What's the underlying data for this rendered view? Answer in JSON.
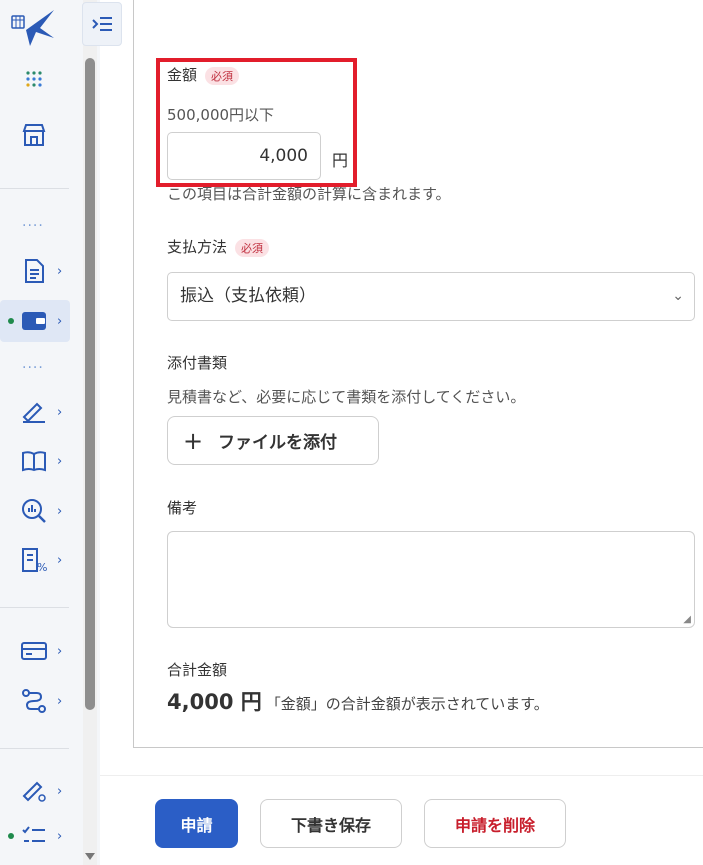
{
  "form": {
    "amount": {
      "label": "金額",
      "required_badge": "必須",
      "limit_text": "500,000円以下",
      "value": "4,000",
      "unit": "円",
      "note": "この項目は合計金額の計算に含まれます。"
    },
    "payment_method": {
      "label": "支払方法",
      "required_badge": "必須",
      "selected": "振込（支払依頼）"
    },
    "attachments": {
      "label": "添付書類",
      "help": "見積書など、必要に応じて書類を添付してください。",
      "button_label": "ファイルを添付"
    },
    "remarks": {
      "label": "備考",
      "value": ""
    },
    "total": {
      "label": "合計金額",
      "amount": "4,000 円",
      "note": "「金額」の合計金額が表示されています。"
    }
  },
  "footer": {
    "apply_label": "申請",
    "draft_label": "下書き保存",
    "delete_label": "申請を削除"
  },
  "colors": {
    "primary": "#2b5ec6",
    "danger": "#c81e2c",
    "highlight": "#e21d2b",
    "sidebar_bg": "#f4f6f9",
    "icon": "#2b5ab6",
    "status_dot": "#1f8a4c"
  },
  "sidebar": {
    "icons": [
      "app-logo-icon",
      "apps-grid-icon",
      "store-icon",
      "document-icon",
      "wallet-icon",
      "signature-icon",
      "book-icon",
      "analytics-search-icon",
      "expense-report-icon",
      "credit-card-icon",
      "workflow-icon",
      "signature-settings-icon",
      "task-list-icon"
    ]
  }
}
